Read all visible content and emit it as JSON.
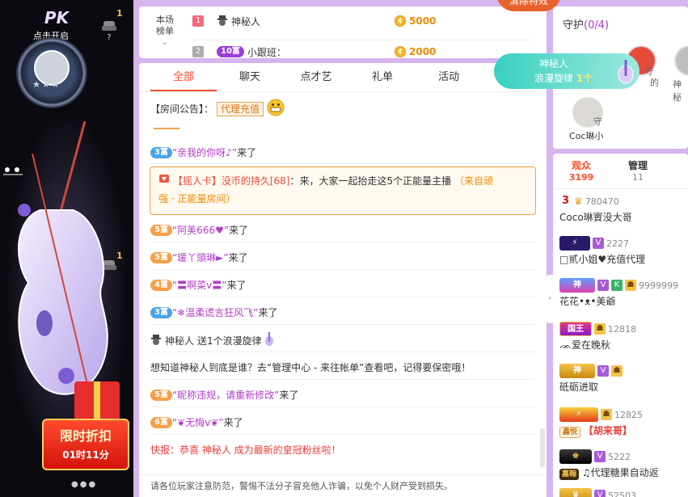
{
  "stage": {
    "pk_label": "PK",
    "pk_sub": "点击开启",
    "stars": "★★★",
    "side_badge_1": "1",
    "side_badge_2": "1",
    "promo_title": "限时折扣",
    "promo_time": "01时11分"
  },
  "rank_board": {
    "label_line1": "本场",
    "label_line2": "榜单",
    "rows": [
      {
        "num": "1",
        "name": "神秘人",
        "amount": "5000",
        "level": ""
      },
      {
        "num": "2",
        "name": "小跟班：",
        "amount": "2000",
        "level": "10富"
      }
    ]
  },
  "top_banner": {
    "label": "清除特效"
  },
  "tabs": [
    "全部",
    "聊天",
    "点才艺",
    "礼单",
    "活动"
  ],
  "chat": {
    "announce_prefix": "【房间公告】：",
    "announce_btn": "代理充值",
    "messages": [
      {
        "level": "3富",
        "name": "“亲我的你呀♪”",
        "suffix": "来了"
      },
      {
        "level": "5富",
        "name": "“阿美666♥”",
        "suffix": "来了"
      },
      {
        "level": "5富",
        "name": "“瑗丫頭琳►”",
        "suffix": "来了"
      },
      {
        "level": "4富",
        "name": "“〓啊菜v〓”",
        "suffix": "来了"
      },
      {
        "level": "3富",
        "name": "“❄温柔谎言狂风飞”",
        "suffix": "来了"
      },
      {
        "level": "5富",
        "name": "“昵称违规，请重新修改”",
        "suffix": "来了"
      },
      {
        "level": "6富",
        "name": "“❦无悔v❦”",
        "suffix": "来了"
      }
    ],
    "shake_card": {
      "tag": "【摇人卡】",
      "name": "没币的持久[68]",
      "text": "：来，大家一起抬走这5个正能量主播",
      "source_line1": "（来自顽",
      "source_line2": "强 · 正能量房间）"
    },
    "gift_line": {
      "name": "神秘人",
      "text": "送1个浪漫旋律"
    },
    "system_line": "想知道神秘人到底是谁？去“管理中心 - 来往帐单”查看吧，记得要保密哦！",
    "flash": "快报：恭喜 神秘人 成为最新的皇冠粉丝啦！",
    "footer_tip": "请各位玩家注意防范，警惕不法分子冒充他人诈骗，以免个人财产受到损失。"
  },
  "guard": {
    "title": "守护",
    "count": "(0/4)",
    "members": [
      {
        "label": "Coc琳小",
        "tag": "守"
      }
    ],
    "partial_labels": [
      "守",
      "的",
      "神秘"
    ]
  },
  "gift_toast": {
    "name": "神秘人",
    "gift": "浪漫旋律",
    "count": "1个"
  },
  "audience": {
    "tabs": [
      {
        "label": "观众",
        "count": "3199"
      },
      {
        "label": "管理",
        "count": "11"
      }
    ],
    "rows": [
      {
        "badge": "3",
        "number": "780470",
        "name": "Coco琳賨没大哥"
      },
      {
        "badge": "",
        "number": "2227",
        "name": "□贰小姐♥充值代理"
      },
      {
        "badge": "神",
        "number": "9999999",
        "name": "花花•ᴥ•美爺"
      },
      {
        "badge": "国王",
        "number": "12818",
        "name": "ᨏ爱在晚秋"
      },
      {
        "badge": "神",
        "number": "",
        "name": "砥砺进取"
      },
      {
        "badge": "鑫悦",
        "number": "12825",
        "name": "【胡来哥】"
      },
      {
        "badge": "嘉翰",
        "number": "5222",
        "name": "♫代理糖果自动返"
      },
      {
        "badge": "",
        "number": "52503",
        "name": ""
      }
    ]
  },
  "colors": {
    "accent": "#ff4a2e",
    "purple": "#b13cc8",
    "gold": "#f08a00",
    "background": "#d6b4ee"
  }
}
